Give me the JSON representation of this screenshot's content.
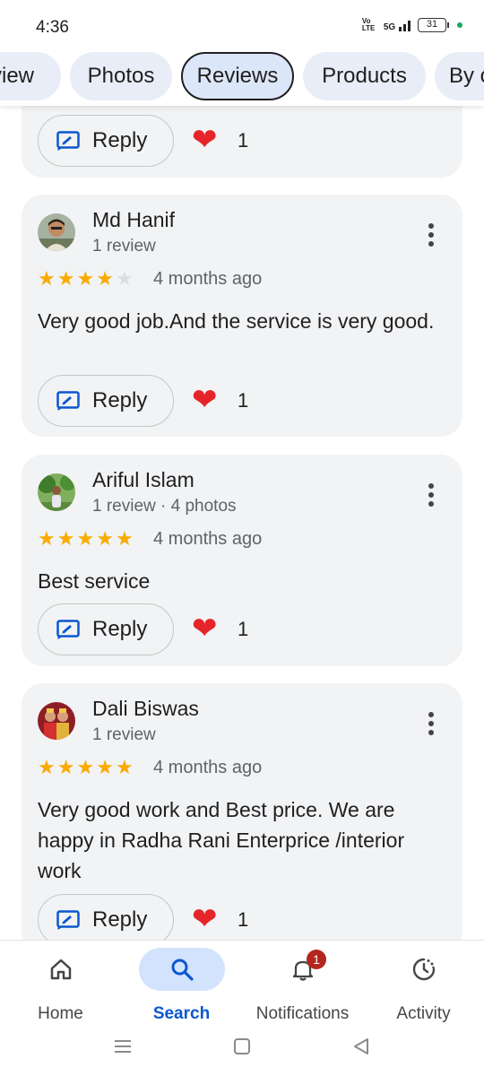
{
  "status": {
    "time": "4:36",
    "network": "5G",
    "volte": "Vo LTE",
    "battery": "31"
  },
  "tabs": [
    {
      "label": "view",
      "active": false
    },
    {
      "label": "Photos",
      "active": false
    },
    {
      "label": "Reviews",
      "active": true
    },
    {
      "label": "Products",
      "active": false
    },
    {
      "label": "By c",
      "active": false
    }
  ],
  "reply_label": "Reply",
  "partial_card": {
    "likes": "1"
  },
  "reviews": [
    {
      "name": "Md Hanif",
      "meta": "1 review",
      "rating": 4,
      "when": "4 months ago",
      "text": "Very good job.And the service is very good.",
      "likes": "1"
    },
    {
      "name": "Ariful Islam",
      "meta": "1 review · 4 photos",
      "rating": 5,
      "when": "4 months ago",
      "text": "Best service",
      "likes": "1"
    },
    {
      "name": "Dali Biswas",
      "meta": "1 review",
      "rating": 5,
      "when": "4 months ago",
      "text": "Very good work and Best price. We are happy in Radha Rani Enterprice /interior work",
      "likes": "1"
    }
  ],
  "bottom_nav": [
    {
      "label": "Home",
      "icon": "home-icon",
      "active": false
    },
    {
      "label": "Search",
      "icon": "search-icon",
      "active": true
    },
    {
      "label": "Notifications",
      "icon": "bell-icon",
      "active": false,
      "badge": "1"
    },
    {
      "label": "Activity",
      "icon": "activity-icon",
      "active": false
    }
  ],
  "colors": {
    "accent": "#0b57d0",
    "star": "#f9ab00",
    "heart": "#e5252a",
    "card": "#f2f3f5",
    "badge": "#b3261e"
  }
}
